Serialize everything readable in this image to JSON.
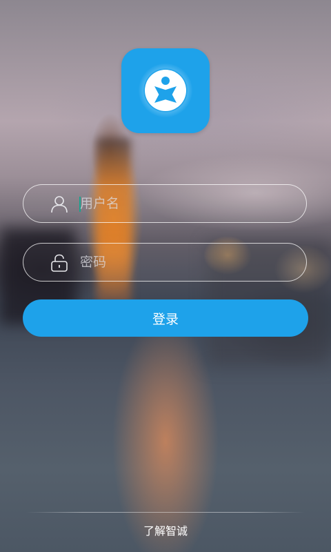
{
  "app": {
    "accent_color": "#1ea2ea"
  },
  "login_form": {
    "username": {
      "placeholder": "用户名",
      "value": "",
      "icon": "user-icon"
    },
    "password": {
      "placeholder": "密码",
      "value": "",
      "icon": "lock-icon"
    },
    "login_button_label": "登录"
  },
  "footer": {
    "about_link": "了解智诚"
  }
}
